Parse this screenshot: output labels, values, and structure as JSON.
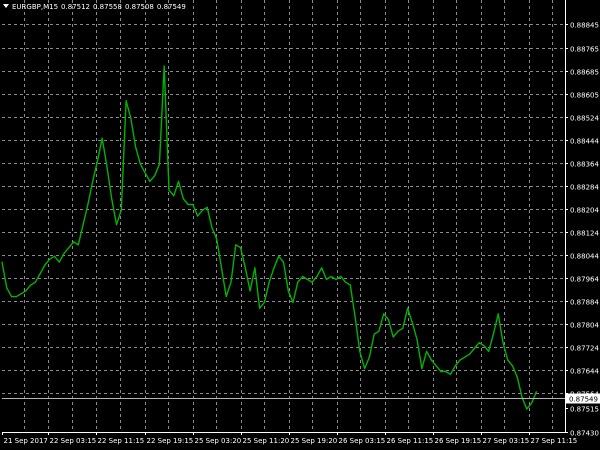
{
  "window": {
    "symbol_timeframe": "EURGBP,M15",
    "ohlc": [
      "0.87512",
      "0.87558",
      "0.87508",
      "0.87549"
    ]
  },
  "colors": {
    "background": "#000000",
    "grid": "#8a8a8a",
    "price_line": "#00b400",
    "bid_line": "#b4b4b4",
    "axis_text": "#ffffff",
    "current_price_label_bg": "#ffffff",
    "current_price_label_text": "#000000"
  },
  "chart_data": {
    "type": "line",
    "symbol": "EURGBP",
    "timeframe": "M15",
    "ylim": [
      0.8743,
      0.8893
    ],
    "y_tick_labels": [
      "0.88845",
      "0.88765",
      "0.88685",
      "0.88605",
      "0.88524",
      "0.88444",
      "0.88364",
      "0.88284",
      "0.88204",
      "0.88124",
      "0.88044",
      "0.87964",
      "0.87884",
      "0.87804",
      "0.87724",
      "0.87644",
      "0.87564",
      "0.87515",
      "0.87430"
    ],
    "y_tick_values": [
      0.88845,
      0.88765,
      0.88685,
      0.88605,
      0.88524,
      0.88444,
      0.88364,
      0.88284,
      0.88204,
      0.88124,
      0.88044,
      0.87964,
      0.87884,
      0.87804,
      0.87724,
      0.87644,
      0.87564,
      0.87515,
      0.8743
    ],
    "x_tick_labels": [
      "21 Sep 2017",
      "22 Sep 03:15",
      "22 Sep 11:15",
      "22 Sep 19:15",
      "25 Sep 03:20",
      "25 Sep 11:20",
      "25 Sep 19:20",
      "26 Sep 03:15",
      "26 Sep 11:15",
      "26 Sep 19:15",
      "27 Sep 03:15",
      "27 Sep 11:15"
    ],
    "x_range": [
      0,
      590
    ],
    "current_price": 0.87549,
    "current_price_label": "0.87549",
    "grid": "dashed",
    "series": [
      {
        "x": [
          0,
          5,
          10,
          15,
          20,
          25,
          30,
          35,
          40,
          45,
          50,
          55,
          60,
          65,
          70,
          75,
          80,
          85,
          90,
          95,
          100,
          105,
          110,
          115,
          120,
          125,
          130,
          135,
          140,
          145,
          150,
          155,
          160,
          165,
          170,
          175,
          180,
          185,
          190,
          195,
          200,
          205,
          210,
          215,
          220,
          225,
          230,
          235,
          240,
          245,
          250,
          255,
          260,
          265,
          270,
          275,
          280,
          285,
          290,
          295,
          300,
          305,
          310,
          315,
          320,
          325,
          330,
          335,
          340,
          345,
          350,
          355,
          360,
          365,
          370,
          375,
          380,
          385,
          390,
          395,
          400,
          405,
          410,
          415,
          420,
          425,
          430,
          435,
          440,
          445,
          450,
          455,
          460,
          465,
          470,
          475,
          480,
          485,
          490,
          495,
          500,
          505,
          510,
          515,
          520,
          525,
          530,
          535,
          540,
          545,
          550,
          555,
          560
        ],
        "values": [
          0.8802,
          0.8793,
          0.879,
          0.879,
          0.8791,
          0.8792,
          0.8794,
          0.8795,
          0.8798,
          0.8801,
          0.8803,
          0.8804,
          0.8802,
          0.8805,
          0.8807,
          0.8809,
          0.8808,
          0.8815,
          0.8822,
          0.883,
          0.8837,
          0.8845,
          0.8835,
          0.8824,
          0.8815,
          0.882,
          0.8858,
          0.8852,
          0.8842,
          0.8836,
          0.8833,
          0.883,
          0.8832,
          0.8836,
          0.887,
          0.8827,
          0.8825,
          0.883,
          0.8824,
          0.8822,
          0.8822,
          0.8818,
          0.882,
          0.8821,
          0.8814,
          0.881,
          0.88,
          0.879,
          0.8795,
          0.8808,
          0.8807,
          0.88,
          0.8792,
          0.88,
          0.8786,
          0.8788,
          0.8795,
          0.88,
          0.8804,
          0.8802,
          0.8792,
          0.8788,
          0.8795,
          0.8797,
          0.8796,
          0.8795,
          0.8797,
          0.88,
          0.8796,
          0.8797,
          0.8796,
          0.8797,
          0.8795,
          0.8794,
          0.8783,
          0.8771,
          0.8765,
          0.8769,
          0.8777,
          0.8778,
          0.8784,
          0.8782,
          0.8776,
          0.8778,
          0.8779,
          0.8786,
          0.8781,
          0.8775,
          0.8765,
          0.8771,
          0.8768,
          0.8766,
          0.8764,
          0.8764,
          0.8763,
          0.8766,
          0.8768,
          0.8769,
          0.877,
          0.8772,
          0.8774,
          0.8773,
          0.8771,
          0.8777,
          0.8784,
          0.8774,
          0.8768,
          0.8766,
          0.8762,
          0.8755,
          0.8751,
          0.8753,
          0.8757
        ]
      }
    ]
  }
}
